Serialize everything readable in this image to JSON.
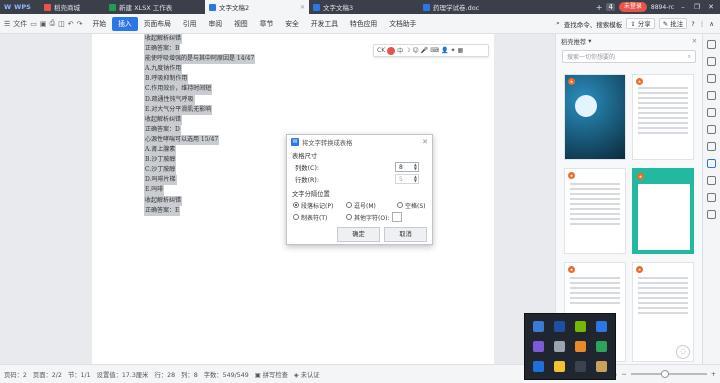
{
  "titlebar": {
    "app": "WPS",
    "tabs": [
      {
        "label": "稻壳商城",
        "color": "#e8534a"
      },
      {
        "label": "新建 XLSX 工作表",
        "color": "#1f9d55"
      },
      {
        "label": "文字文稿2",
        "color": "#2b78e4",
        "active": true
      },
      {
        "label": "文字文稿3",
        "color": "#2b78e4"
      },
      {
        "label": "药理学试卷.doc",
        "color": "#2b78e4"
      }
    ],
    "tab_count": "4",
    "login": "未登录",
    "user_id": "8894-rc"
  },
  "menubar": {
    "file_label": "文件",
    "items": [
      "开始",
      "插入",
      "页面布局",
      "引用",
      "审阅",
      "视图",
      "章节",
      "安全",
      "开发工具",
      "特色应用",
      "文档助手"
    ],
    "active_index": 1,
    "search": "查找命令、搜索模板",
    "share": "分享",
    "comment": "批注"
  },
  "document": {
    "lines": [
      "收起解析纠错",
      "正确答案：B",
      "能使呼吸增强的是与其中阿原因是 14/47",
      "A.九度钠作用",
      "B.呼吸抑制作用",
      "C.作用效价，维持时间短",
      "D.疏通性钝气呼吸",
      "E.对大气分平滑肌无影响",
      "收起解析纠错",
      "正确答案：D",
      "心源性哮喘可以选用 15/47",
      "A.肾上腺素",
      "B.沙丁胺醇",
      "C.沙丁胺醇",
      "D.吗啡片梯",
      "E.吗啡",
      "收起解析纠错",
      "正确答案：E"
    ]
  },
  "mini_toolbar": {
    "label": "CK"
  },
  "dialog": {
    "title": "将文字转换成表格",
    "size_section": "表格尺寸",
    "cols_label": "列数(C):",
    "cols_value": "8",
    "rows_label": "行数(R):",
    "rows_value": "5",
    "sep_section": "文字分隔位置",
    "options": [
      "段落标记(P)",
      "逗号(M)",
      "空格(S)",
      "制表符(T)",
      "其他字符(O):"
    ],
    "selected_option": 0,
    "ok": "确定",
    "cancel": "取消"
  },
  "right_panel": {
    "title": "稻壳推荐",
    "search_placeholder": "搜索一切你想要的"
  },
  "statusbar": {
    "page": "页码：2",
    "pages": "页面：2/2",
    "section": "节：1/1",
    "position": "设置值：17.3厘米",
    "row": "行：28",
    "col": "列：8",
    "words": "字数：549/549",
    "spell": "拼写检查",
    "cert": "未认证"
  }
}
